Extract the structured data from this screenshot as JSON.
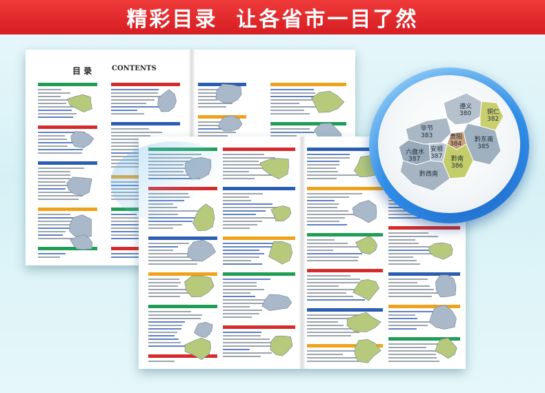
{
  "banner": {
    "title": "精彩目录  让各省市一目了然"
  },
  "toc": {
    "title": "目   录",
    "subtitle": "CONTENTS"
  },
  "magnifier": {
    "regions": [
      {
        "name": "遵义",
        "page": "380"
      },
      {
        "name": "铜仁",
        "page": "382"
      },
      {
        "name": "毕节",
        "page": "383"
      },
      {
        "name": "贵阳",
        "page": "384"
      },
      {
        "name": "黔东南",
        "page": "385"
      },
      {
        "name": "黔南",
        "page": "386"
      },
      {
        "name": "安顺",
        "page": "387"
      },
      {
        "name": "六盘水",
        "page": "387"
      },
      {
        "name": "黔西南",
        "page": ""
      }
    ]
  },
  "colors": {
    "banner_red": "#e02a2e",
    "section_blue": "#2b5db3",
    "section_green": "#1f9d55",
    "section_orange": "#f0a21b",
    "section_red": "#d62b2b",
    "lens_blue": "#2f8de6"
  }
}
